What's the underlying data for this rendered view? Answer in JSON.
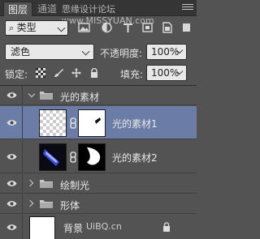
{
  "tabs": {
    "layers": "图层",
    "channels": "通道"
  },
  "watermark": "思缘设计论坛 www.MISSYUAN.com",
  "filter": {
    "kind_label": "类型",
    "icons": [
      "image-filter-icon",
      "adjustment-filter-icon",
      "text-filter-icon",
      "shape-filter-icon",
      "smart-object-filter-icon",
      "filter-toggle-icon"
    ]
  },
  "blend": {
    "mode": "滤色",
    "opacity_label": "不透明度:",
    "opacity_value": "100%"
  },
  "lock": {
    "label": "锁定:",
    "fill_label": "填充:",
    "fill_value": "100%"
  },
  "layers": [
    {
      "name": "光的素材",
      "type": "group",
      "expanded": true
    },
    {
      "name": "光的素材1",
      "type": "layer-with-mask",
      "selected": true
    },
    {
      "name": "光的素材2",
      "type": "layer-with-mask"
    },
    {
      "name": "绘制光",
      "type": "group",
      "expanded": false
    },
    {
      "name": "形体",
      "type": "group",
      "expanded": false
    },
    {
      "name": "背景",
      "type": "background",
      "locked": true
    }
  ],
  "bottom_watermark": "UiBQ.cn",
  "colors": {
    "panel": "#535353",
    "selected": "#6b7ca6",
    "tabbar": "#353535"
  }
}
